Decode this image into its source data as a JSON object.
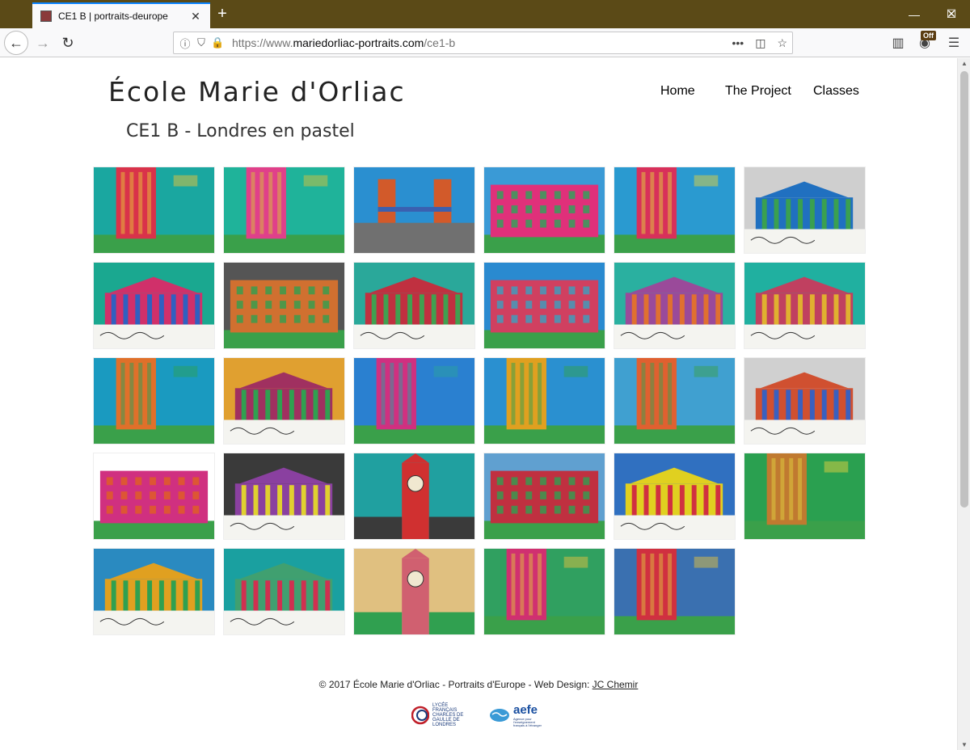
{
  "browser": {
    "tab_title": "CE1 B | portraits-deurope",
    "url_prefix": "https://www.",
    "url_host": "mariedorliac-portraits.com",
    "url_path": "/ce1-b",
    "off_badge": "Off",
    "new_tab_glyph": "+",
    "minimize_glyph": "—",
    "maximize_glyph": "☐",
    "close_glyph": "✕",
    "tab_close_glyph": "✕"
  },
  "site": {
    "title": "École Marie d'Orliac",
    "nav": [
      "Home",
      "The Project",
      "Classes"
    ],
    "page_title": "CE1 B - Londres en pastel"
  },
  "gallery": {
    "thumbnails": [
      {
        "subject": "tower",
        "sky": "#1aa7a0",
        "main": "#d9324a",
        "accent": "#e8c43a"
      },
      {
        "subject": "tower",
        "sky": "#1fb39a",
        "main": "#e0408a",
        "accent": "#d6c23c"
      },
      {
        "subject": "bridge",
        "sky": "#2a8fd0",
        "main": "#d25a2a",
        "accent": "#e0c33e"
      },
      {
        "subject": "building",
        "sky": "#3a9ad6",
        "main": "#e0307a",
        "accent": "#2aa65a"
      },
      {
        "subject": "tower",
        "sky": "#2a9ad0",
        "main": "#d8305a",
        "accent": "#e0d040"
      },
      {
        "subject": "museum",
        "sky": "#cfcfcf",
        "main": "#2070c0",
        "accent": "#3aa050"
      },
      {
        "subject": "museum",
        "sky": "#1aa890",
        "main": "#d0306a",
        "accent": "#3060c0"
      },
      {
        "subject": "building",
        "sky": "#555555",
        "main": "#d07030",
        "accent": "#30a050"
      },
      {
        "subject": "museum",
        "sky": "#2aa89a",
        "main": "#c03040",
        "accent": "#40a050"
      },
      {
        "subject": "building",
        "sky": "#2a8ad0",
        "main": "#d04060",
        "accent": "#3aa0c0"
      },
      {
        "subject": "museum",
        "sky": "#2ab0a0",
        "main": "#9a4a9a",
        "accent": "#e07030"
      },
      {
        "subject": "museum",
        "sky": "#20b0a0",
        "main": "#c04060",
        "accent": "#e0b030"
      },
      {
        "subject": "tower",
        "sky": "#1a9ac0",
        "main": "#e0702a",
        "accent": "#2aa05a"
      },
      {
        "subject": "museum",
        "sky": "#e0a030",
        "main": "#a03060",
        "accent": "#30a050"
      },
      {
        "subject": "tower",
        "sky": "#2a80d0",
        "main": "#d03080",
        "accent": "#2aa0a0"
      },
      {
        "subject": "tower",
        "sky": "#2a90d0",
        "main": "#e0a020",
        "accent": "#30a050"
      },
      {
        "subject": "tower",
        "sky": "#40a0d0",
        "main": "#e06030",
        "accent": "#3aa050"
      },
      {
        "subject": "museum",
        "sky": "#d0d0d0",
        "main": "#d05030",
        "accent": "#3a60c0"
      },
      {
        "subject": "building",
        "sky": "#ffffff",
        "main": "#d03080",
        "accent": "#e06020"
      },
      {
        "subject": "museum",
        "sky": "#3a3a3a",
        "main": "#8a40a0",
        "accent": "#e0d030"
      },
      {
        "subject": "bigben",
        "sky": "#20a0a0",
        "main": "#d03030",
        "accent": "#3a3a3a"
      },
      {
        "subject": "building",
        "sky": "#60a0d0",
        "main": "#c03040",
        "accent": "#30a050"
      },
      {
        "subject": "museum",
        "sky": "#3070c0",
        "main": "#e0d020",
        "accent": "#d03040"
      },
      {
        "subject": "tower",
        "sky": "#2aa050",
        "main": "#c07a30",
        "accent": "#e0d040"
      },
      {
        "subject": "museum",
        "sky": "#2a8ac0",
        "main": "#e0a020",
        "accent": "#30a050"
      },
      {
        "subject": "museum",
        "sky": "#1aa0a0",
        "main": "#40a070",
        "accent": "#d03050"
      },
      {
        "subject": "bigben",
        "sky": "#e0c080",
        "main": "#d06070",
        "accent": "#30a050"
      },
      {
        "subject": "tower",
        "sky": "#30a060",
        "main": "#d03070",
        "accent": "#e0c040"
      },
      {
        "subject": "tower",
        "sky": "#3a70b0",
        "main": "#d03040",
        "accent": "#e0c040"
      }
    ]
  },
  "footer": {
    "text": "© 2017 École Marie d'Orliac - Portraits d'Europe - Web Design: ",
    "link": "JC Chemir",
    "logo1_text": "LYCÉE FRANÇAIS CHARLES DE GAULLE DE LONDRES",
    "logo2_text": "aefe",
    "logo2_sub": "Agence pour l'enseignement français à l'étranger"
  },
  "colors": {
    "titlebar": "#5b4a17",
    "tab_accent": "#0a84ff",
    "lock": "#2aa832"
  }
}
